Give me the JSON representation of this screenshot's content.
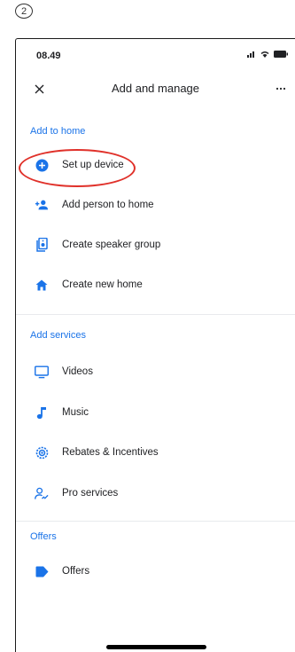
{
  "annotation": {
    "step_number": "2",
    "highlight_color": "#e0312a"
  },
  "status_bar": {
    "time": "08.49"
  },
  "app_bar": {
    "title": "Add and manage"
  },
  "sections": {
    "add_to_home": "Add to home",
    "add_services": "Add services",
    "offers": "Offers"
  },
  "items": {
    "set_up_device": {
      "label": "Set up device",
      "icon": "add-circle-icon"
    },
    "add_person": {
      "label": "Add person to home",
      "icon": "person-add-icon"
    },
    "speaker_group": {
      "label": "Create speaker group",
      "icon": "speaker-group-icon"
    },
    "new_home": {
      "label": "Create new home",
      "icon": "home-icon"
    },
    "videos": {
      "label": "Videos",
      "icon": "tv-icon"
    },
    "music": {
      "label": "Music",
      "icon": "music-note-icon"
    },
    "rebates": {
      "label": "Rebates & Incentives",
      "icon": "rebate-icon"
    },
    "pro_services": {
      "label": "Pro services",
      "icon": "pro-services-icon"
    },
    "offers": {
      "label": "Offers",
      "icon": "tag-icon"
    }
  },
  "colors": {
    "accent": "#1a73e8",
    "text": "#202124",
    "icon": "#1a73e8"
  }
}
